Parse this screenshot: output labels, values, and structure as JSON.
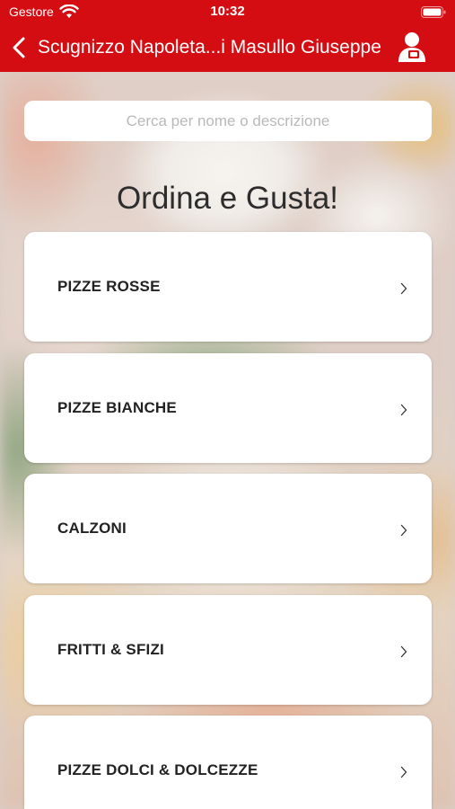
{
  "status_bar": {
    "carrier": "Gestore",
    "time": "10:32"
  },
  "nav": {
    "title": "Scugnizzo Napoleta...i Masullo Giuseppe"
  },
  "search": {
    "placeholder": "Cerca per nome o descrizione",
    "value": ""
  },
  "page": {
    "title": "Ordina e Gusta!"
  },
  "categories": [
    {
      "label": "PIZZE ROSSE"
    },
    {
      "label": "PIZZE BIANCHE"
    },
    {
      "label": "CALZONI"
    },
    {
      "label": "FRITTI & SFIZI"
    },
    {
      "label": "PIZZE DOLCI & DOLCEZZE"
    }
  ],
  "colors": {
    "brand": "#d40d13"
  },
  "icons": {
    "back": "back-chevron-icon",
    "profile": "user-profile-icon",
    "row": "chevron-right-icon"
  }
}
